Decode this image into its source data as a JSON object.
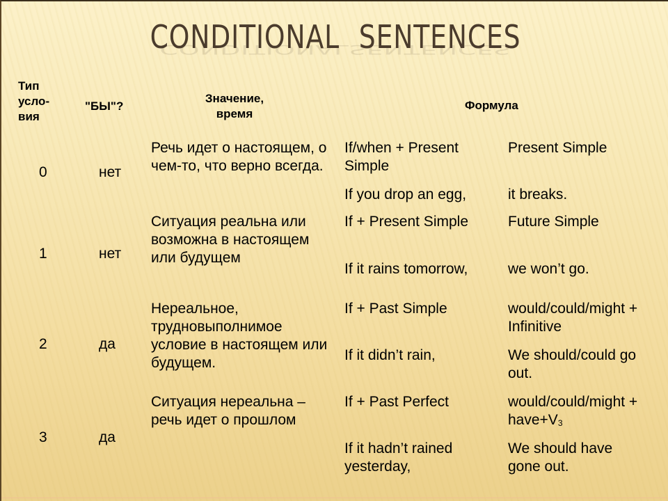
{
  "title": {
    "word1": "CONDITIONAL",
    "word2": "SENTENCES"
  },
  "table": {
    "headers": {
      "type": "Тип усло-вия",
      "type_lines": [
        "Тип",
        "усло-",
        "вия"
      ],
      "by": "\"БЫ\"?",
      "meaning_lines": [
        "Значение,",
        "время"
      ],
      "formula": "Формула"
    },
    "rows": [
      {
        "type": "0",
        "by": "нет",
        "meaning": "Речь идет о настоящем, о чем-то, что верно всегда.",
        "formula_if": "If/when + Present Simple",
        "formula_main": "Present Simple",
        "example_if": "If you drop an egg,",
        "example_main": "it breaks."
      },
      {
        "type": "1",
        "by": "нет",
        "meaning": "Ситуация реальна или возможна в настоящем или будущем",
        "formula_if": "If + Present Simple",
        "formula_main": "Future Simple",
        "example_if": "If it rains tomorrow,",
        "example_main": "we won’t go."
      },
      {
        "type": "2",
        "by": "да",
        "meaning": "Нереальное, трудновыполнимое условие в настоящем или будущем.",
        "formula_if": "If + Past Simple",
        "formula_main": "would/could/might + Infinitive",
        "example_if": "If it didn’t rain,",
        "example_main": "We should/could go out."
      },
      {
        "type": "3",
        "by": "да",
        "meaning": "Ситуация нереальна – речь идет о прошлом",
        "formula_if": "If + Past Perfect",
        "formula_main_prefix": "would/could/might + have+V",
        "formula_main_sub": "3",
        "example_if": "If it hadn’t rained yesterday,",
        "example_main": "We should have gone out."
      }
    ]
  }
}
